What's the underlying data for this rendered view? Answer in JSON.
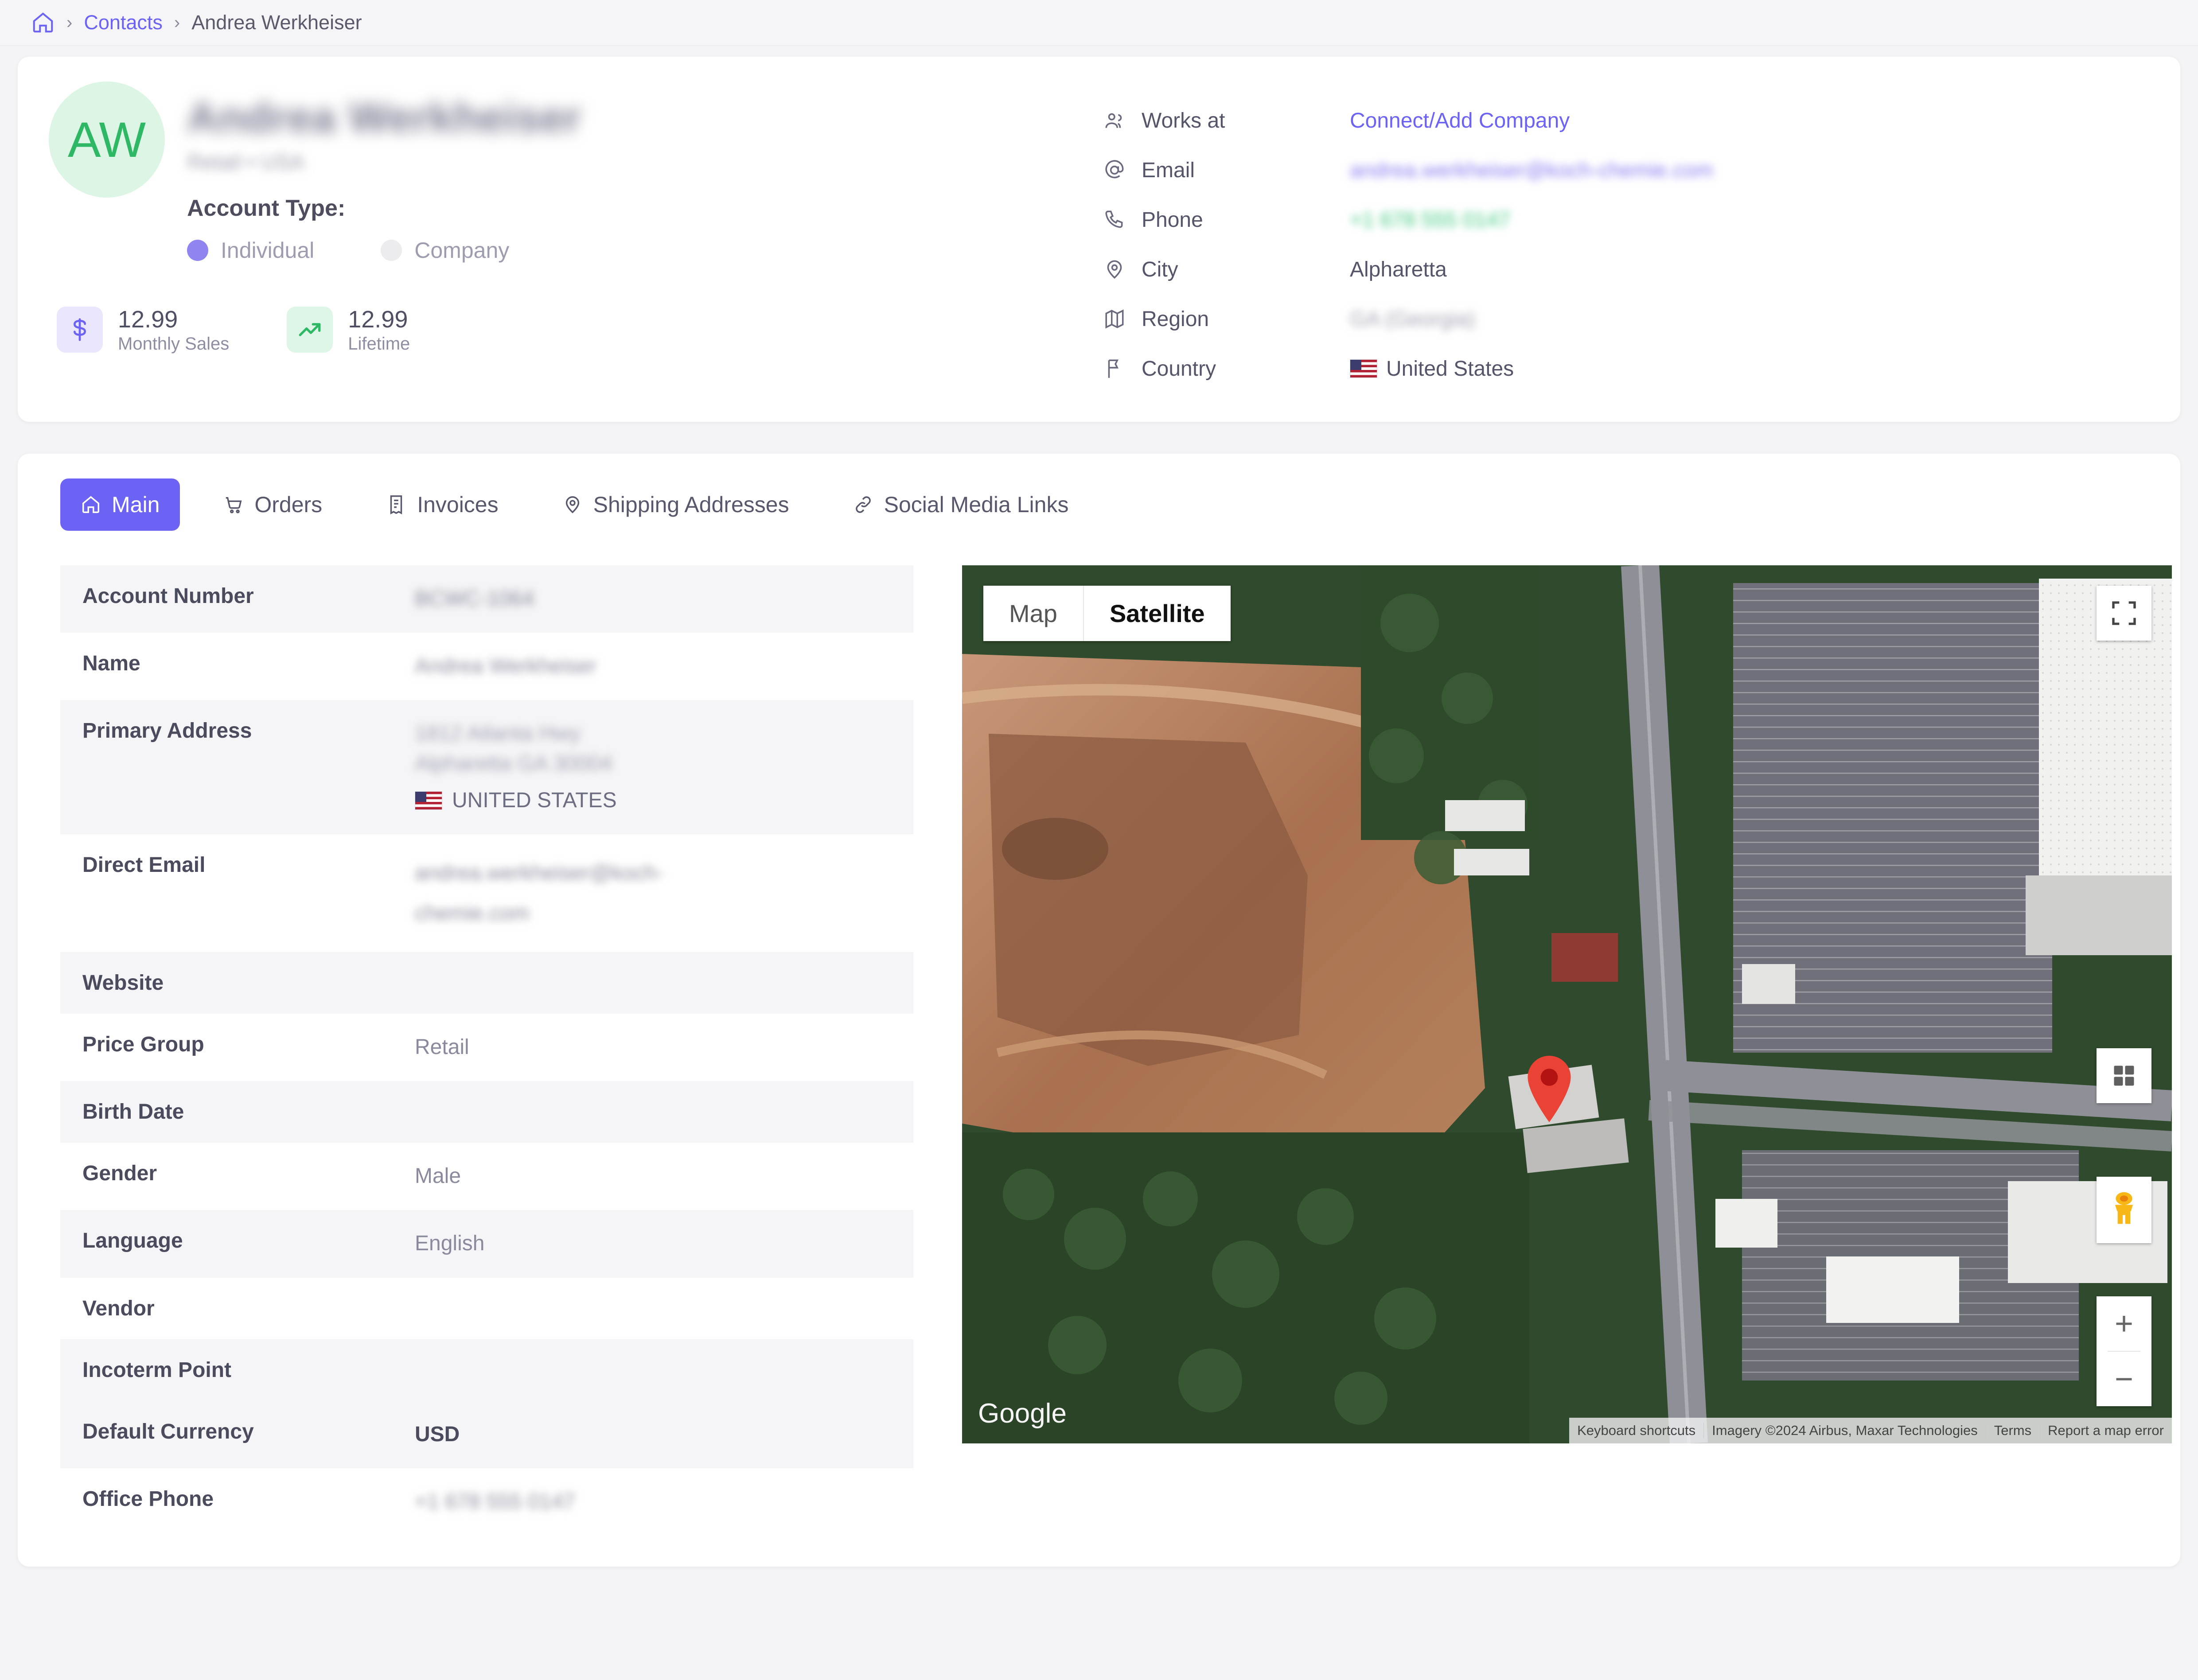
{
  "breadcrumb": {
    "home_icon": "home-icon",
    "separator": "›",
    "link": "Contacts",
    "current": "Andrea Werkheiser"
  },
  "header": {
    "avatar_initials": "AW",
    "name_redacted": "Andrea Werkheiser",
    "subtitle_redacted": "Retail • USA",
    "account_type_label": "Account Type:",
    "account_type_options": [
      {
        "label": "Individual",
        "selected": true
      },
      {
        "label": "Company",
        "selected": false
      }
    ],
    "stats": [
      {
        "icon": "dollar-icon",
        "value": "12.99",
        "caption": "Monthly Sales",
        "accent": "#6c63f5"
      },
      {
        "icon": "trending-up-icon",
        "value": "12.99",
        "caption": "Lifetime",
        "accent": "#2eb866"
      }
    ],
    "contact_info": [
      {
        "icon": "users-icon",
        "label": "Works at",
        "value": "Connect/Add Company",
        "style": "link"
      },
      {
        "icon": "at-icon",
        "label": "Email",
        "value": "andrea.werkheiser@koch-chemie.com",
        "style": "blur-purple"
      },
      {
        "icon": "phone-icon",
        "label": "Phone",
        "value": "+1 678 555 0147",
        "style": "blur-green"
      },
      {
        "icon": "pin-icon",
        "label": "City",
        "value": "Alpharetta",
        "style": "plain"
      },
      {
        "icon": "map-icon",
        "label": "Region",
        "value": "GA (Georgia)",
        "style": "blur-gray"
      },
      {
        "icon": "flag-icon",
        "label": "Country",
        "value": "United States",
        "style": "flag"
      }
    ]
  },
  "tabs": [
    {
      "label": "Main",
      "icon": "home-icon",
      "active": true
    },
    {
      "label": "Orders",
      "icon": "cart-icon",
      "active": false
    },
    {
      "label": "Invoices",
      "icon": "receipt-icon",
      "active": false
    },
    {
      "label": "Shipping Addresses",
      "icon": "pin-icon",
      "active": false
    },
    {
      "label": "Social Media Links",
      "icon": "link-icon",
      "active": false
    }
  ],
  "details": [
    {
      "key": "Account Number",
      "value": "BCWC-1064",
      "style": "blur"
    },
    {
      "key": "Name",
      "value": "Andrea Werkheiser",
      "style": "blur"
    },
    {
      "key": "Primary Address",
      "value": "1812 Atlanta Hwy\nAlpharetta GA 30004",
      "country": "UNITED STATES",
      "style": "blur-address"
    },
    {
      "key": "Direct Email",
      "value": "andrea.werkheiser@koch-\nchemie.com",
      "style": "blur-link"
    },
    {
      "key": "Website",
      "value": "",
      "style": "plain"
    },
    {
      "key": "Price Group",
      "value": "Retail",
      "style": "plain"
    },
    {
      "key": "Birth Date",
      "value": "",
      "style": "plain"
    },
    {
      "key": "Gender",
      "value": "Male",
      "style": "plain"
    },
    {
      "key": "Language",
      "value": "English",
      "style": "plain"
    },
    {
      "key": "Vendor",
      "value": "",
      "style": "plain"
    },
    {
      "key": "Incoterm Point",
      "value": "",
      "style": "plain"
    },
    {
      "key": "Default Currency",
      "value": "USD",
      "style": "strong"
    },
    {
      "key": "Office Phone",
      "value": "+1 678 555 0147",
      "style": "blur-green"
    }
  ],
  "map": {
    "types": [
      {
        "label": "Map",
        "selected": false
      },
      {
        "label": "Satellite",
        "selected": true
      }
    ],
    "controls": {
      "fullscreen_icon": "fullscreen-icon",
      "maptype_icon": "grid-icon",
      "pegman_icon": "pegman-icon",
      "zoom_in": "+",
      "zoom_out": "−"
    },
    "watermark": "Google",
    "attribution": [
      "Keyboard shortcuts",
      "Imagery ©2024 Airbus, Maxar Technologies",
      "Terms",
      "Report a map error"
    ],
    "marker": "location-marker"
  }
}
